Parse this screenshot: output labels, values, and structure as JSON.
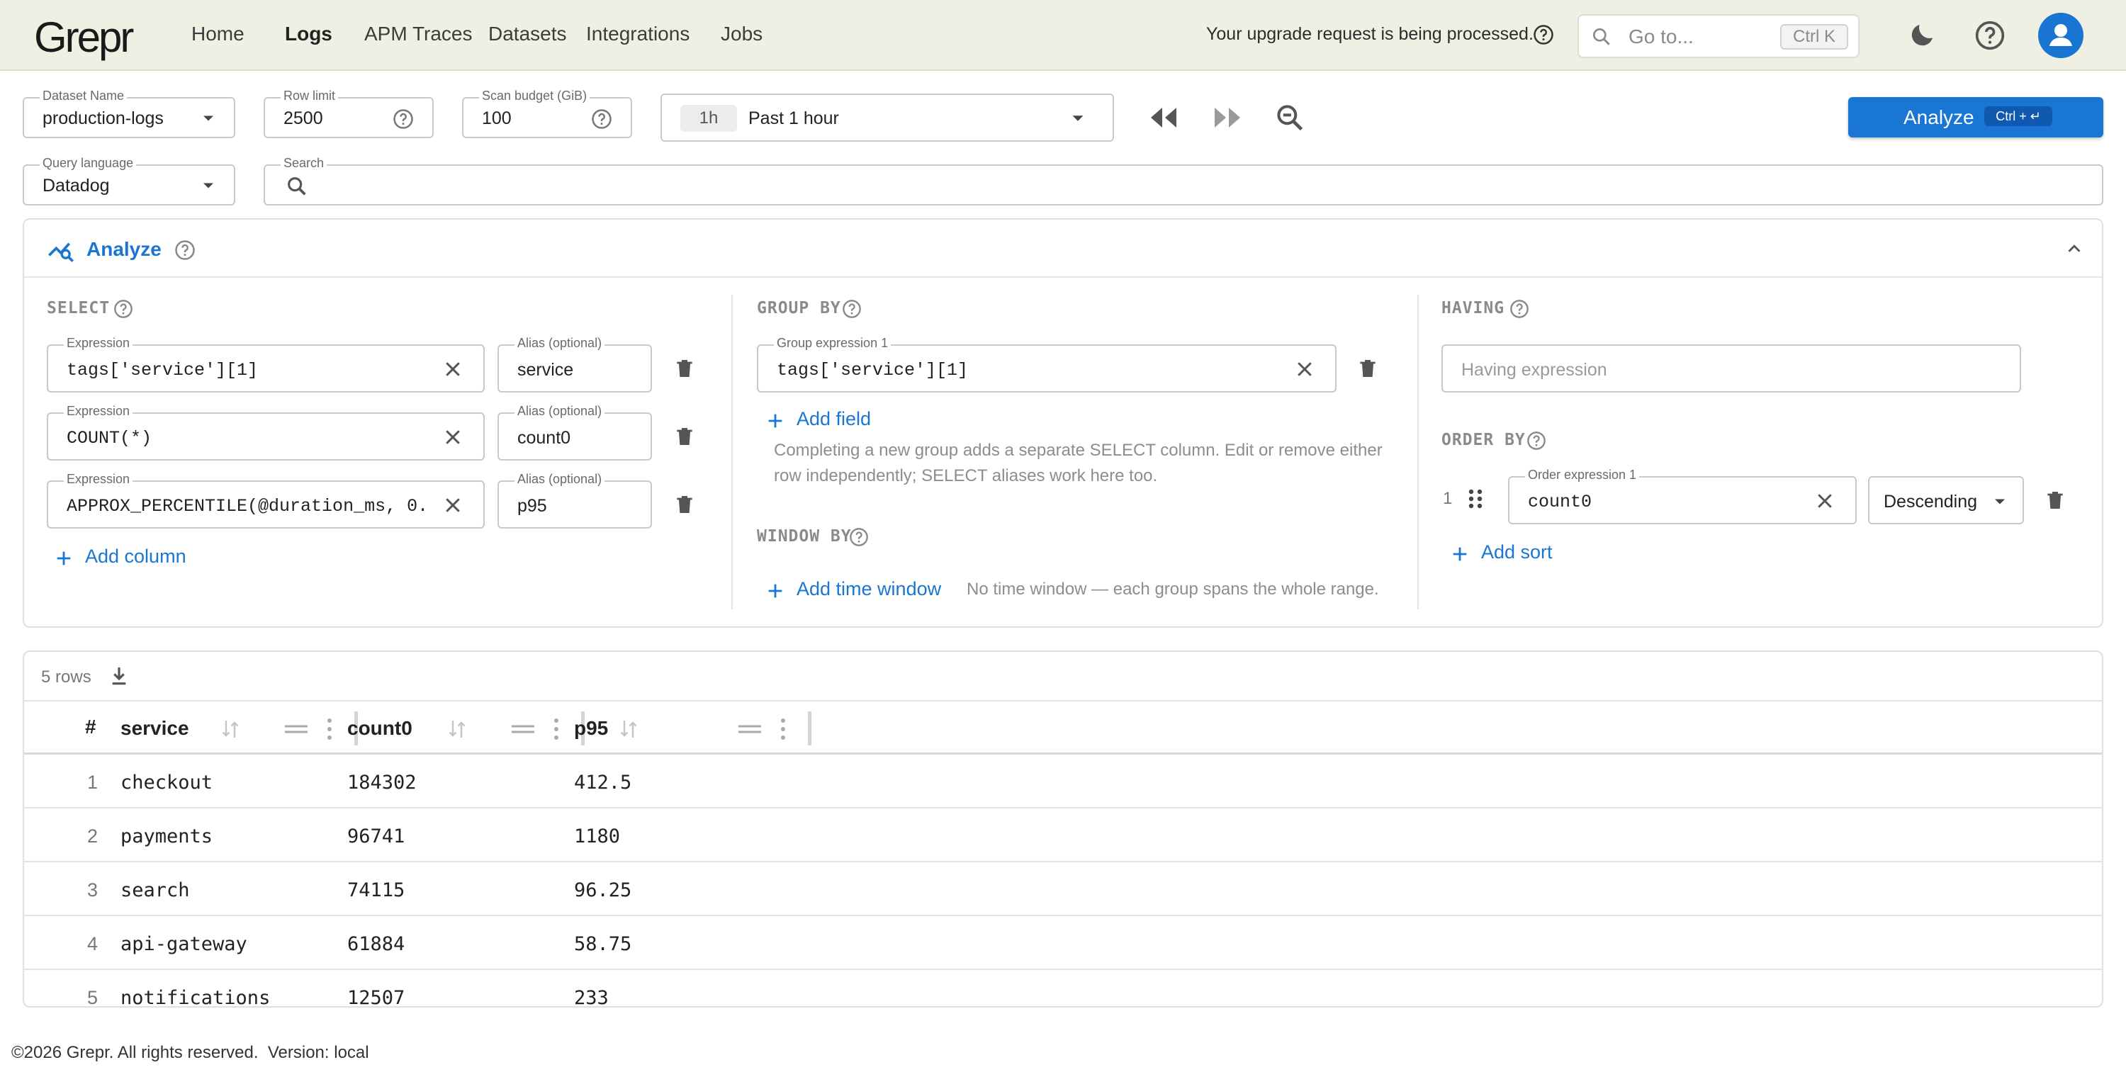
{
  "brand": {
    "logo": "Grepr",
    "accent": "#1976d2"
  },
  "nav": {
    "items": [
      {
        "label": "Home",
        "active": false
      },
      {
        "label": "Logs",
        "active": true
      },
      {
        "label": "APM Traces",
        "active": false
      },
      {
        "label": "Datasets",
        "active": false
      },
      {
        "label": "Integrations",
        "active": false
      },
      {
        "label": "Jobs",
        "active": false
      }
    ],
    "upgrade_notice": "Your upgrade request is being processed.",
    "goto_placeholder": "Go to...",
    "goto_shortcut": "Ctrl K"
  },
  "query": {
    "dataset": {
      "label": "Dataset Name",
      "value": "production-logs"
    },
    "row_limit": {
      "label": "Row limit",
      "value": "2500"
    },
    "scan_budget": {
      "label": "Scan budget (GiB)",
      "value": "100"
    },
    "time": {
      "chip": "1h",
      "value": "Past 1 hour"
    },
    "analyze_button": {
      "label": "Analyze",
      "shortcut": "Ctrl + ↵"
    },
    "language": {
      "label": "Query language",
      "value": "Datadog"
    },
    "search": {
      "label": "Search",
      "value": ""
    }
  },
  "analyze_panel": {
    "title": "Analyze",
    "select": {
      "heading": "SELECT",
      "expr_label": "Expression",
      "alias_label": "Alias (optional)",
      "rows": [
        {
          "expression": "tags['service'][1]",
          "alias": "service"
        },
        {
          "expression": "COUNT(*)",
          "alias": "count0"
        },
        {
          "expression": "APPROX_PERCENTILE(@duration_ms, 0.…",
          "alias": "p95"
        }
      ],
      "add_label": "Add column"
    },
    "group_by": {
      "heading": "GROUP BY",
      "expr_label": "Group expression 1",
      "expression": "tags['service'][1]",
      "add_label": "Add field",
      "hint": "Completing a new group adds a separate SELECT column. Edit or remove either row independently; SELECT aliases work here too."
    },
    "window_by": {
      "heading": "WINDOW BY",
      "add_label": "Add time window",
      "hint": "No time window — each group spans the whole range."
    },
    "having": {
      "heading": "HAVING",
      "placeholder": "Having expression"
    },
    "order_by": {
      "heading": "ORDER BY",
      "index": "1",
      "expr_label": "Order expression 1",
      "expression": "count0",
      "direction": "Descending",
      "add_label": "Add sort"
    }
  },
  "results": {
    "row_count": "5 rows",
    "columns": [
      "#",
      "service",
      "count0",
      "p95"
    ],
    "rows": [
      {
        "n": "1",
        "service": "checkout",
        "count0": "184302",
        "p95": "412.5"
      },
      {
        "n": "2",
        "service": "payments",
        "count0": "96741",
        "p95": "1180"
      },
      {
        "n": "3",
        "service": "search",
        "count0": "74115",
        "p95": "96.25"
      },
      {
        "n": "4",
        "service": "api-gateway",
        "count0": "61884",
        "p95": "58.75"
      },
      {
        "n": "5",
        "service": "notifications",
        "count0": "12507",
        "p95": "233"
      }
    ]
  },
  "footer": "©2026 Grepr. All rights reserved.  Version: local"
}
